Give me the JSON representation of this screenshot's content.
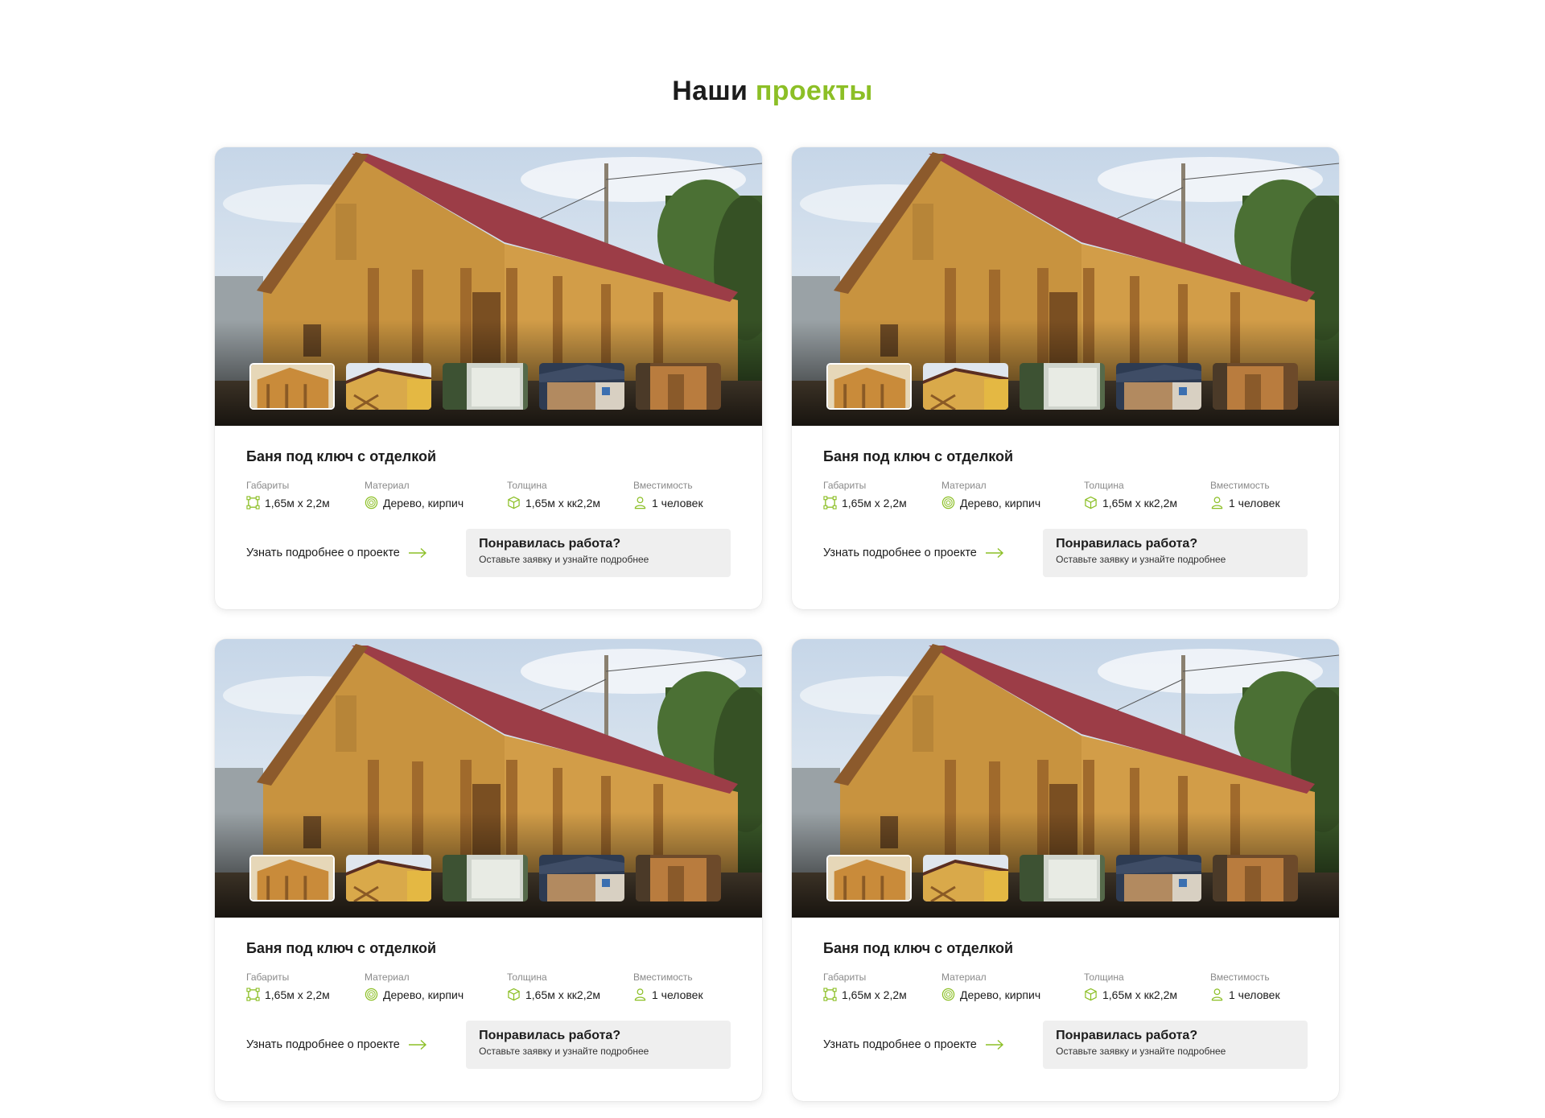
{
  "section": {
    "title_main": "Наши",
    "title_accent": "проекты"
  },
  "accent_color": "#8cbf26",
  "projects": [
    {
      "title": "Баня под ключ с отделкой",
      "specs": [
        {
          "label": "Габариты",
          "value": "1,65м х 2,2м",
          "icon": "dimensions-icon"
        },
        {
          "label": "Материал",
          "value": "Дерево, кирпич",
          "icon": "material-icon"
        },
        {
          "label": "Толщина",
          "value": "1,65м х кк2,2м",
          "icon": "cube-icon"
        },
        {
          "label": "Вместимость",
          "value": "1 человек",
          "icon": "person-icon"
        }
      ],
      "more_label": "Узнать подробнее о проекте",
      "cta_title": "Понравилась работа?",
      "cta_sub": "Оставьте заявку и узнайте подробнее"
    },
    {
      "title": "Баня под ключ с отделкой",
      "specs": [
        {
          "label": "Габариты",
          "value": "1,65м х 2,2м",
          "icon": "dimensions-icon"
        },
        {
          "label": "Материал",
          "value": "Дерево, кирпич",
          "icon": "material-icon"
        },
        {
          "label": "Толщина",
          "value": "1,65м х кк2,2м",
          "icon": "cube-icon"
        },
        {
          "label": "Вместимость",
          "value": "1 человек",
          "icon": "person-icon"
        }
      ],
      "more_label": "Узнать подробнее о проекте",
      "cta_title": "Понравилась работа?",
      "cta_sub": "Оставьте заявку и узнайте подробнее"
    },
    {
      "title": "Баня под ключ с отделкой",
      "specs": [
        {
          "label": "Габариты",
          "value": "1,65м х 2,2м",
          "icon": "dimensions-icon"
        },
        {
          "label": "Материал",
          "value": "Дерево, кирпич",
          "icon": "material-icon"
        },
        {
          "label": "Толщина",
          "value": "1,65м х кк2,2м",
          "icon": "cube-icon"
        },
        {
          "label": "Вместимость",
          "value": "1 человек",
          "icon": "person-icon"
        }
      ],
      "more_label": "Узнать подробнее о проекте",
      "cta_title": "Понравилась работа?",
      "cta_sub": "Оставьте заявку и узнайте подробнее"
    },
    {
      "title": "Баня под ключ с отделкой",
      "specs": [
        {
          "label": "Габариты",
          "value": "1,65м х 2,2м",
          "icon": "dimensions-icon"
        },
        {
          "label": "Материал",
          "value": "Дерево, кирпич",
          "icon": "material-icon"
        },
        {
          "label": "Толщина",
          "value": "1,65м х кк2,2м",
          "icon": "cube-icon"
        },
        {
          "label": "Вместимость",
          "value": "1 человек",
          "icon": "person-icon"
        }
      ],
      "more_label": "Узнать подробнее о проекте",
      "cta_title": "Понравилась работа?",
      "cta_sub": "Оставьте заявку и узнайте подробнее"
    }
  ]
}
